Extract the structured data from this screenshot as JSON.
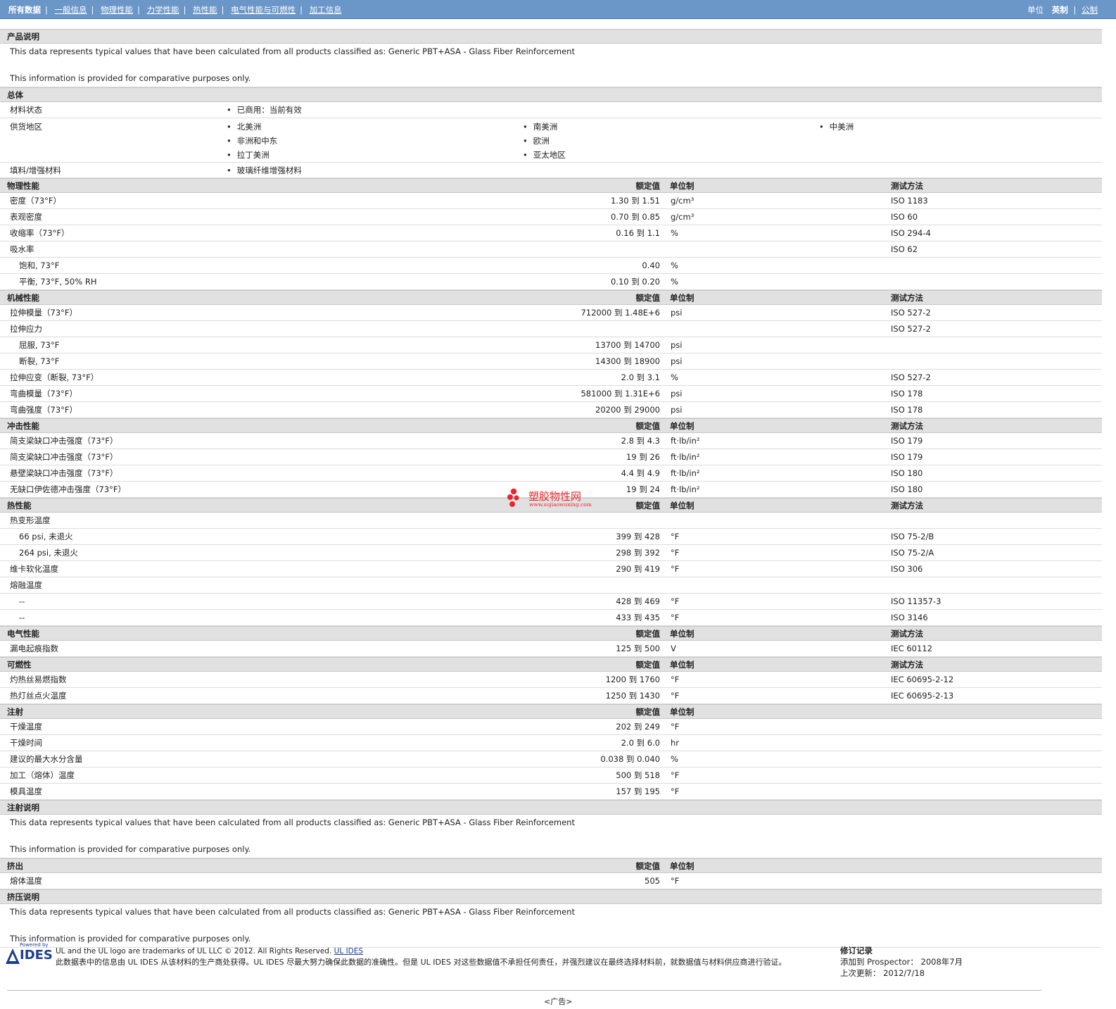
{
  "nav": {
    "items": [
      "所有数据",
      "一般信息",
      "物理性能",
      "力学性能",
      "热性能",
      "电气性能与可燃性",
      "加工信息"
    ],
    "units_label": "单位",
    "units_options": [
      "英制",
      "公制"
    ]
  },
  "product": {
    "title": "产品说明",
    "line1": "This data represents typical values that have been calculated from all products classified as: Generic PBT+ASA - Glass Fiber Reinforcement",
    "line2": "This information is provided for comparative purposes only."
  },
  "general": {
    "title": "总体",
    "status_label": "材料状态",
    "status_value": "已商用：当前有效",
    "regions_label": "供货地区",
    "regions_col1": [
      "北美洲",
      "非洲和中东",
      "拉丁美洲"
    ],
    "regions_col2": [
      "南美洲",
      "欧洲",
      "亚太地区"
    ],
    "regions_col3": [
      "中美洲"
    ],
    "filler_label": "填料/增强材料",
    "filler_value": "玻璃纤维增强材料"
  },
  "headers": {
    "rated": "额定值",
    "unit": "单位制",
    "test": "测试方法"
  },
  "physical": {
    "title": "物理性能",
    "rows": [
      {
        "label": "密度（73°F）",
        "value": "1.30 到  1.51",
        "unit": "g/cm³",
        "test": "ISO 1183"
      },
      {
        "label": "表观密度",
        "value": "0.70 到  0.85",
        "unit": "g/cm³",
        "test": "ISO 60"
      },
      {
        "label": "收缩率（73°F）",
        "value": "0.16 到  1.1",
        "unit": "%",
        "test": "ISO 294-4"
      },
      {
        "label": "吸水率",
        "value": "",
        "unit": "",
        "test": "ISO 62"
      },
      {
        "label": "饱和, 73°F",
        "value": "0.40",
        "unit": "%",
        "test": "",
        "sub": true
      },
      {
        "label": "平衡, 73°F, 50% RH",
        "value": "0.10 到  0.20",
        "unit": "%",
        "test": "",
        "sub": true
      }
    ]
  },
  "mechanical": {
    "title": "机械性能",
    "rows": [
      {
        "label": "拉伸模量（73°F）",
        "value": "712000 到  1.48E+6",
        "unit": "psi",
        "test": "ISO 527-2"
      },
      {
        "label": "拉伸应力",
        "value": "",
        "unit": "",
        "test": "ISO 527-2"
      },
      {
        "label": "屈服, 73°F",
        "value": "13700 到  14700",
        "unit": "psi",
        "test": "",
        "sub": true
      },
      {
        "label": "断裂, 73°F",
        "value": "14300 到  18900",
        "unit": "psi",
        "test": "",
        "sub": true
      },
      {
        "label": "拉伸应变（断裂, 73°F）",
        "value": "2.0 到  3.1",
        "unit": "%",
        "test": "ISO 527-2"
      },
      {
        "label": "弯曲模量（73°F）",
        "value": "581000 到  1.31E+6",
        "unit": "psi",
        "test": "ISO 178"
      },
      {
        "label": "弯曲强度（73°F）",
        "value": "20200 到  29000",
        "unit": "psi",
        "test": "ISO 178"
      }
    ]
  },
  "impact": {
    "title": "冲击性能",
    "rows": [
      {
        "label": "简支梁缺口冲击强度（73°F）",
        "value": "2.8 到  4.3",
        "unit": "ft·lb/in²",
        "test": "ISO 179"
      },
      {
        "label": "简支梁缺口冲击强度（73°F）",
        "value": "19 到  26",
        "unit": "ft·lb/in²",
        "test": "ISO 179"
      },
      {
        "label": "悬壁梁缺口冲击强度（73°F）",
        "value": "4.4 到  4.9",
        "unit": "ft·lb/in²",
        "test": "ISO 180"
      },
      {
        "label": "无缺口伊佐德冲击强度（73°F）",
        "value": "19 到  24",
        "unit": "ft·lb/in²",
        "test": "ISO 180"
      }
    ]
  },
  "thermal": {
    "title": "热性能",
    "rows": [
      {
        "label": "热变形温度",
        "value": "",
        "unit": "",
        "test": ""
      },
      {
        "label": "66 psi, 未退火",
        "value": "399 到  428",
        "unit": "°F",
        "test": "ISO 75-2/B",
        "sub": true
      },
      {
        "label": "264 psi, 未退火",
        "value": "298 到  392",
        "unit": "°F",
        "test": "ISO 75-2/A",
        "sub": true
      },
      {
        "label": "维卡软化温度",
        "value": "290 到  419",
        "unit": "°F",
        "test": "ISO 306"
      },
      {
        "label": "熔融温度",
        "value": "",
        "unit": "",
        "test": ""
      },
      {
        "label": "--",
        "value": "428 到  469",
        "unit": "°F",
        "test": "ISO 11357-3",
        "sub": true
      },
      {
        "label": "--",
        "value": "433 到  435",
        "unit": "°F",
        "test": "ISO 3146",
        "sub": true
      }
    ]
  },
  "electrical": {
    "title": "电气性能",
    "rows": [
      {
        "label": "漏电起痕指数",
        "value": "125 到  500",
        "unit": "V",
        "test": "IEC 60112"
      }
    ]
  },
  "flammability": {
    "title": "可燃性",
    "rows": [
      {
        "label": "灼热丝易燃指数",
        "value": "1200 到  1760",
        "unit": "°F",
        "test": "IEC 60695-2-12"
      },
      {
        "label": "热灯丝点火温度",
        "value": "1250 到  1430",
        "unit": "°F",
        "test": "IEC 60695-2-13"
      }
    ]
  },
  "injection": {
    "title": "注射",
    "rows": [
      {
        "label": "干燥温度",
        "value": "202 到  249",
        "unit": "°F",
        "test": ""
      },
      {
        "label": "干燥时间",
        "value": "2.0 到  6.0",
        "unit": "hr",
        "test": ""
      },
      {
        "label": "建议的最大水分含量",
        "value": "0.038 到  0.040",
        "unit": "%",
        "test": ""
      },
      {
        "label": "加工（熔体）温度",
        "value": "500 到  518",
        "unit": "°F",
        "test": ""
      },
      {
        "label": "模具温度",
        "value": "157 到  195",
        "unit": "°F",
        "test": ""
      }
    ]
  },
  "injection_note": {
    "title": "注射说明",
    "line1": "This data represents typical values that have been calculated from all products classified as: Generic PBT+ASA - Glass Fiber Reinforcement",
    "line2": "This information is provided for comparative purposes only."
  },
  "extrusion": {
    "title": "挤出",
    "rows": [
      {
        "label": "熔体温度",
        "value": "505",
        "unit": "°F",
        "test": ""
      }
    ]
  },
  "extrusion_note": {
    "title": "挤压说明",
    "line1": "This data represents typical values that have been calculated from all products classified as: Generic PBT+ASA - Glass Fiber Reinforcement",
    "line2": "This information is provided for comparative purposes only."
  },
  "watermark": {
    "text": "塑胶物性网",
    "url": "www.sujiaowuxing.com"
  },
  "footer": {
    "logo_top": "Powered by",
    "logo_name": "IDES",
    "trademark": "UL and the UL logo are trademarks of UL LLC © 2012. All Rights Reserved.",
    "link": "UL IDES",
    "disclaimer": "此数据表中的信息由 UL IDES 从该材料的生产商处获得。UL IDES 尽最大努力确保此数据的准确性。但是 UL IDES 对这些数据值不承担任何责任，并强烈建议在最终选择材料前，就数据值与材料供应商进行验证。",
    "rev_title": "修订记录",
    "added": "添加到 Prospector： 2008年7月",
    "updated": "上次更新： 2012/7/18"
  },
  "ad": "<广告>",
  "colors": {
    "topbar": "#6b96c8",
    "section_bg": "#e1e1e1",
    "watermark": "#e8262c"
  }
}
